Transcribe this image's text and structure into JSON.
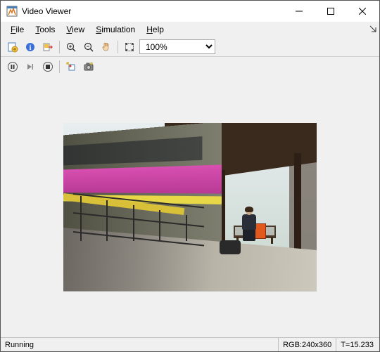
{
  "window": {
    "title": "Video Viewer"
  },
  "menu": {
    "file": "File",
    "tools": "Tools",
    "view": "View",
    "simulation": "Simulation",
    "help": "Help"
  },
  "toolbar": {
    "zoom_value": "100%",
    "icons": {
      "new": "new-figure-icon",
      "info": "info-icon",
      "export": "export-icon",
      "zoom_in": "zoom-in-icon",
      "zoom_out": "zoom-out-icon",
      "pan": "pan-icon",
      "fit": "fit-to-view-icon",
      "pause": "pause-icon",
      "step": "step-forward-icon",
      "stop": "stop-icon",
      "highlight": "highlight-block-icon",
      "snapshot": "snapshot-icon"
    }
  },
  "status": {
    "state": "Running",
    "format": "RGB:240x360",
    "time": "T=15.233"
  }
}
